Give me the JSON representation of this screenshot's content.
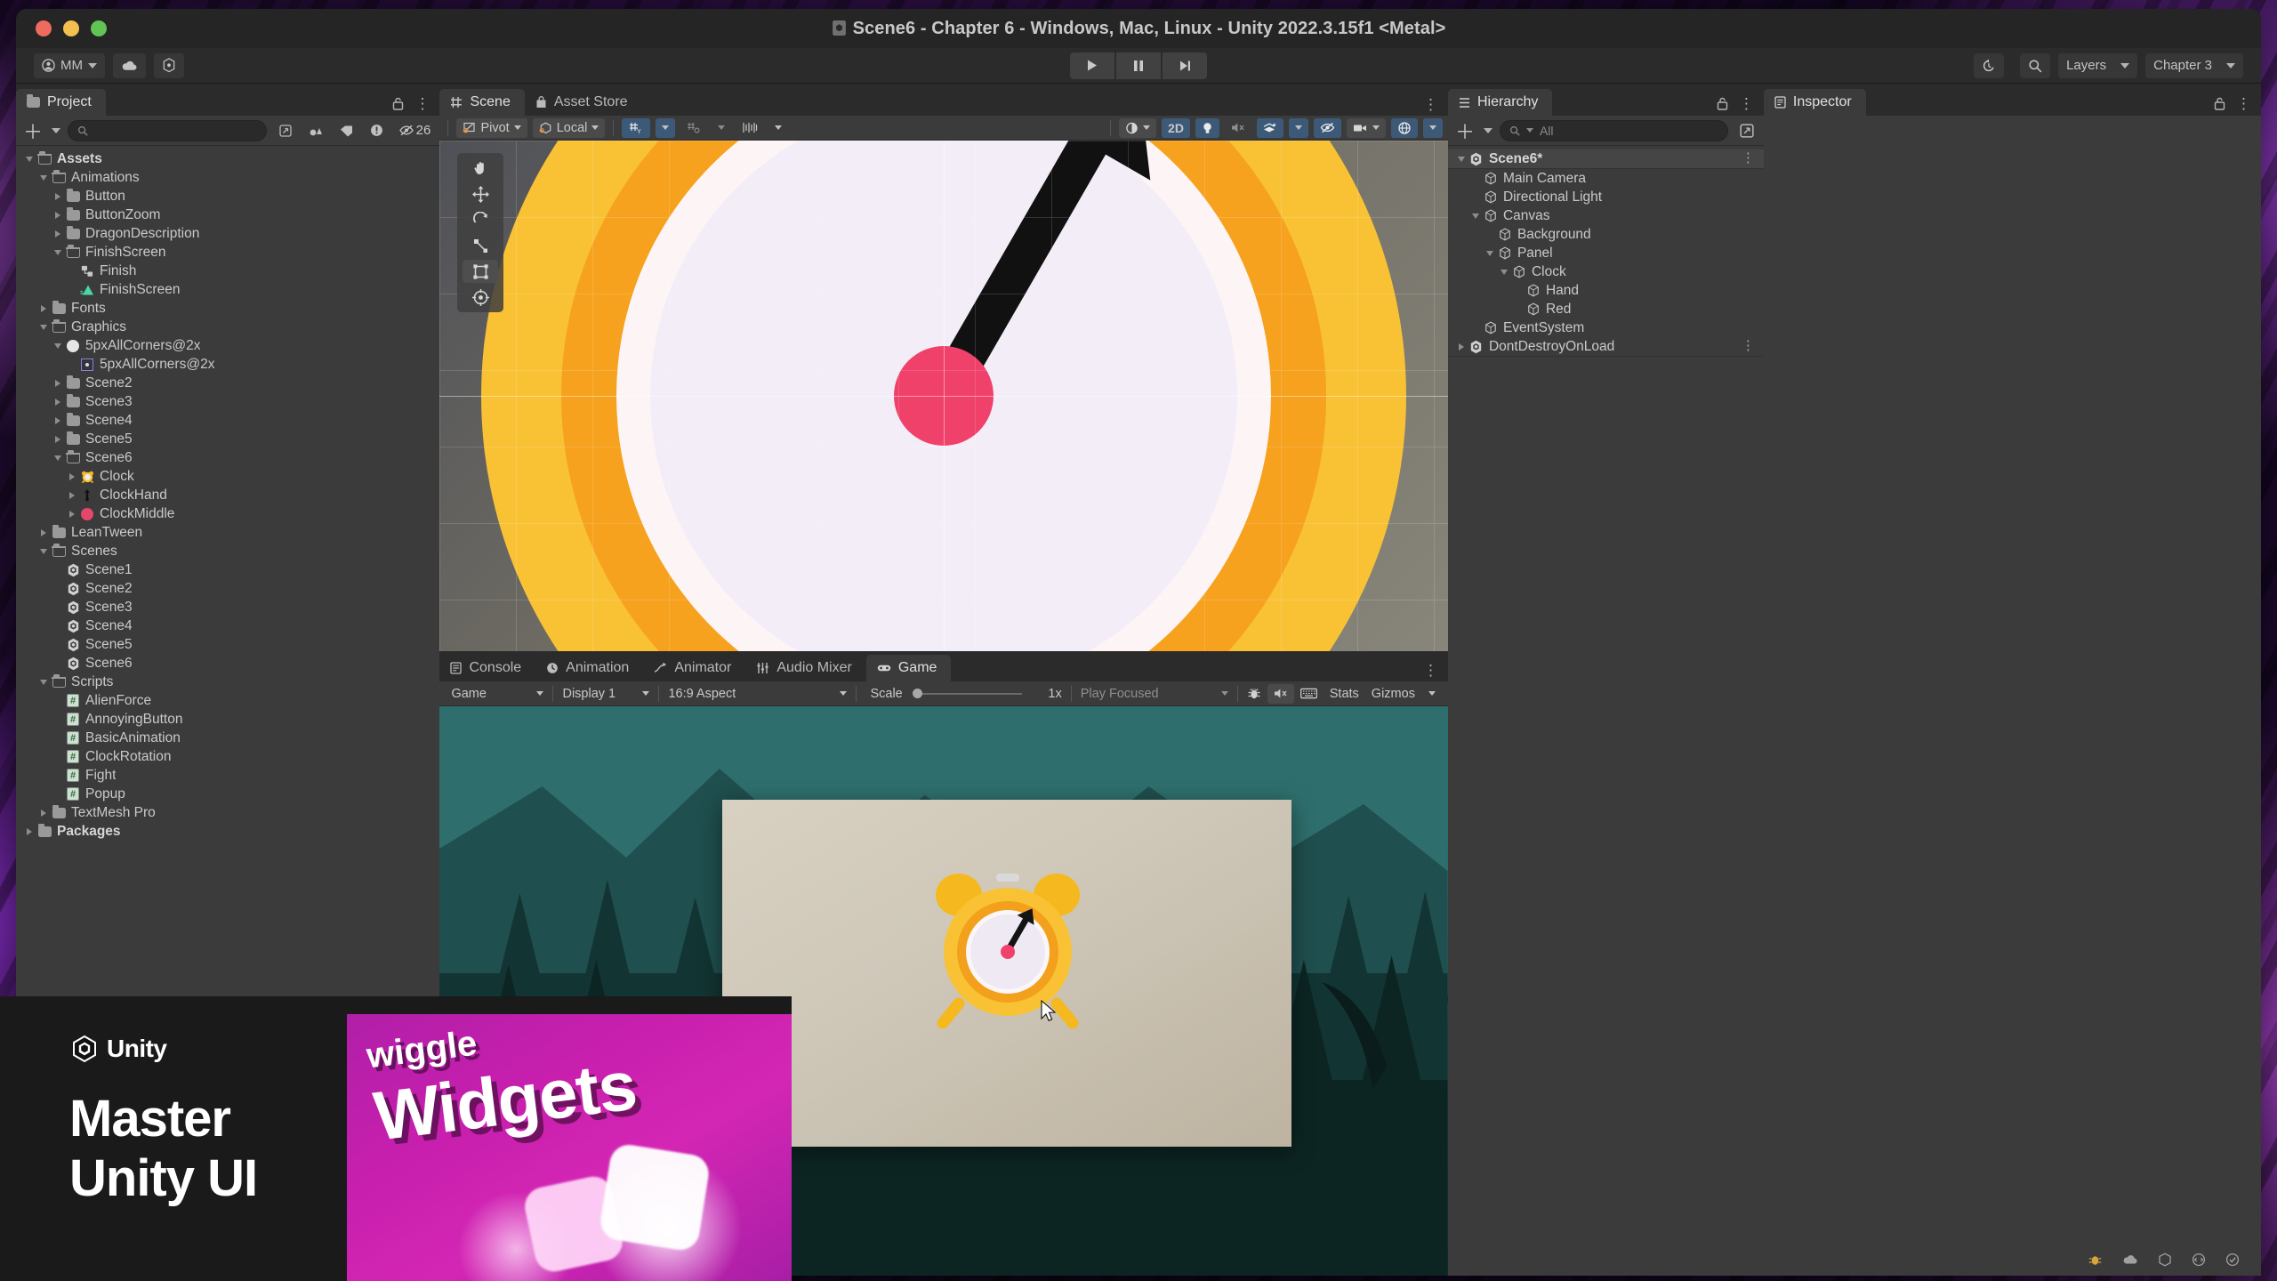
{
  "window": {
    "title": "Scene6 - Chapter 6 - Windows, Mac, Linux - Unity 2022.3.15f1 <Metal>",
    "title_icon": "unity-scene-icon"
  },
  "toolbar": {
    "account_label": "MM",
    "account_icon": "person-icon",
    "cloud_icon": "cloud-icon",
    "services_icon": "unity-services-icon",
    "play_icon": "play-icon",
    "pause_icon": "pause-icon",
    "step_icon": "step-icon",
    "history_icon": "undo-history-icon",
    "search_icon": "search-icon",
    "layers_label": "Layers",
    "layout_label": "Chapter 3"
  },
  "project": {
    "tab_label": "Project",
    "tab_icon": "folder-icon",
    "lock_icon": "lock-icon",
    "menu_icon": "kebab-menu-icon",
    "add_label": "+",
    "search_placeholder": "",
    "search_icon": "search-icon",
    "filter_icons": [
      "object-filter-icon",
      "label-filter-icon",
      "warning-filter-icon",
      "hidden-filter-icon"
    ],
    "hidden_count": "26",
    "tree": [
      {
        "label": "Assets",
        "depth": 0,
        "icon": "folder-open-icon",
        "expanded": true,
        "bold": true
      },
      {
        "label": "Animations",
        "depth": 1,
        "icon": "folder-open-icon",
        "expanded": true
      },
      {
        "label": "Button",
        "depth": 2,
        "icon": "folder-icon",
        "expanded": false
      },
      {
        "label": "ButtonZoom",
        "depth": 2,
        "icon": "folder-icon",
        "expanded": false
      },
      {
        "label": "DragonDescription",
        "depth": 2,
        "icon": "folder-icon",
        "expanded": false
      },
      {
        "label": "FinishScreen",
        "depth": 2,
        "icon": "folder-open-icon",
        "expanded": true
      },
      {
        "label": "Finish",
        "depth": 3,
        "icon": "animator-controller-icon"
      },
      {
        "label": "FinishScreen",
        "depth": 3,
        "icon": "animation-clip-icon"
      },
      {
        "label": "Fonts",
        "depth": 1,
        "icon": "folder-icon",
        "expanded": false
      },
      {
        "label": "Graphics",
        "depth": 1,
        "icon": "folder-open-icon",
        "expanded": true
      },
      {
        "label": "5pxAllCorners@2x",
        "depth": 2,
        "icon": "texture-circle-icon",
        "expanded": true
      },
      {
        "label": "5pxAllCorners@2x",
        "depth": 3,
        "icon": "sprite-icon"
      },
      {
        "label": "Scene2",
        "depth": 2,
        "icon": "folder-icon",
        "expanded": false
      },
      {
        "label": "Scene3",
        "depth": 2,
        "icon": "folder-icon",
        "expanded": false
      },
      {
        "label": "Scene4",
        "depth": 2,
        "icon": "folder-icon",
        "expanded": false
      },
      {
        "label": "Scene5",
        "depth": 2,
        "icon": "folder-icon",
        "expanded": false
      },
      {
        "label": "Scene6",
        "depth": 2,
        "icon": "folder-open-icon",
        "expanded": true
      },
      {
        "label": "Clock",
        "depth": 3,
        "icon": "alarm-clock-texture-icon",
        "expanded": false
      },
      {
        "label": "ClockHand",
        "depth": 3,
        "icon": "clock-hand-texture-icon",
        "expanded": false
      },
      {
        "label": "ClockMiddle",
        "depth": 3,
        "icon": "pink-circle-texture-icon",
        "expanded": false
      },
      {
        "label": "LeanTween",
        "depth": 1,
        "icon": "folder-icon",
        "expanded": false
      },
      {
        "label": "Scenes",
        "depth": 1,
        "icon": "folder-open-icon",
        "expanded": true
      },
      {
        "label": "Scene1",
        "depth": 2,
        "icon": "unity-scene-icon"
      },
      {
        "label": "Scene2",
        "depth": 2,
        "icon": "unity-scene-icon"
      },
      {
        "label": "Scene3",
        "depth": 2,
        "icon": "unity-scene-icon"
      },
      {
        "label": "Scene4",
        "depth": 2,
        "icon": "unity-scene-icon"
      },
      {
        "label": "Scene5",
        "depth": 2,
        "icon": "unity-scene-icon"
      },
      {
        "label": "Scene6",
        "depth": 2,
        "icon": "unity-scene-icon"
      },
      {
        "label": "Scripts",
        "depth": 1,
        "icon": "folder-open-icon",
        "expanded": true
      },
      {
        "label": "AlienForce",
        "depth": 2,
        "icon": "csharp-script-icon"
      },
      {
        "label": "AnnoyingButton",
        "depth": 2,
        "icon": "csharp-script-icon"
      },
      {
        "label": "BasicAnimation",
        "depth": 2,
        "icon": "csharp-script-icon"
      },
      {
        "label": "ClockRotation",
        "depth": 2,
        "icon": "csharp-script-icon"
      },
      {
        "label": "Fight",
        "depth": 2,
        "icon": "csharp-script-icon"
      },
      {
        "label": "Popup",
        "depth": 2,
        "icon": "csharp-script-icon"
      },
      {
        "label": "TextMesh Pro",
        "depth": 1,
        "icon": "folder-icon",
        "expanded": false
      },
      {
        "label": "Packages",
        "depth": 0,
        "icon": "folder-icon",
        "expanded": false,
        "bold": true
      }
    ]
  },
  "scene_panel": {
    "tabs": [
      {
        "label": "Scene",
        "icon": "scene-grid-icon",
        "active": true
      },
      {
        "label": "Asset Store",
        "icon": "asset-store-bag-icon",
        "active": false
      }
    ],
    "menu_icon": "kebab-menu-icon",
    "toolbar": {
      "pivot_label": "Pivot",
      "pivot_icon": "pivot-icon",
      "local_label": "Local",
      "local_icon": "local-space-icon",
      "grid_icon": "grid-axis-y-icon",
      "snap_icon": "snap-increment-icon",
      "ruler_icon": "grid-size-icon",
      "shading_icon": "shading-mode-icon",
      "mode_2d_label": "2D",
      "light_icon": "lighting-icon",
      "audio_icon": "audio-mute-icon",
      "fx_icon": "effects-icon",
      "visibility_icon": "scene-visibility-icon",
      "camera_icon": "scene-camera-icon",
      "gizmos_icon": "gizmos-globe-icon"
    },
    "tools": [
      "hand-tool-icon",
      "move-tool-icon",
      "rotate-tool-icon",
      "scale-tool-icon",
      "rect-tool-icon",
      "transform-tool-icon"
    ],
    "active_tool": "rect-tool-icon"
  },
  "bottom_panel": {
    "tabs": [
      {
        "label": "Console",
        "icon": "console-icon",
        "active": false
      },
      {
        "label": "Animation",
        "icon": "animation-clock-icon",
        "active": false
      },
      {
        "label": "Animator",
        "icon": "animator-arrow-icon",
        "active": false
      },
      {
        "label": "Audio Mixer",
        "icon": "audio-mixer-icon",
        "active": false
      },
      {
        "label": "Game",
        "icon": "gamepad-icon",
        "active": true
      }
    ],
    "menu_icon": "kebab-menu-icon",
    "game_toolbar": {
      "target_label": "Game",
      "display_label": "Display 1",
      "aspect_label": "16:9 Aspect",
      "scale_label": "Scale",
      "scale_value": "1x",
      "play_mode_label": "Play Focused",
      "mute_icon": "audio-mute-icon",
      "debug_icon": "debug-bug-icon",
      "shortcuts_icon": "keyboard-shortcuts-icon",
      "stats_label": "Stats",
      "gizmos_label": "Gizmos"
    }
  },
  "hierarchy": {
    "tab_label": "Hierarchy",
    "tab_icon": "hierarchy-list-icon",
    "lock_icon": "lock-icon",
    "menu_icon": "kebab-menu-icon",
    "add_label": "+",
    "search_placeholder": "All",
    "search_icon": "search-icon",
    "expand_icon": "expand-window-icon",
    "items": [
      {
        "label": "Scene6*",
        "depth": 0,
        "icon": "unity-scene-icon",
        "expanded": true,
        "bold": true,
        "menu": true
      },
      {
        "label": "Main Camera",
        "depth": 1,
        "icon": "gameobject-cube-icon"
      },
      {
        "label": "Directional Light",
        "depth": 1,
        "icon": "gameobject-cube-icon"
      },
      {
        "label": "Canvas",
        "depth": 1,
        "icon": "gameobject-cube-icon",
        "expanded": true
      },
      {
        "label": "Background",
        "depth": 2,
        "icon": "gameobject-cube-icon"
      },
      {
        "label": "Panel",
        "depth": 2,
        "icon": "gameobject-cube-icon",
        "expanded": true
      },
      {
        "label": "Clock",
        "depth": 3,
        "icon": "gameobject-cube-icon",
        "expanded": true
      },
      {
        "label": "Hand",
        "depth": 4,
        "icon": "gameobject-cube-icon"
      },
      {
        "label": "Red",
        "depth": 4,
        "icon": "gameobject-cube-icon"
      },
      {
        "label": "EventSystem",
        "depth": 1,
        "icon": "gameobject-cube-icon"
      },
      {
        "label": "DontDestroyOnLoad",
        "depth": 0,
        "icon": "unity-scene-icon",
        "expanded": false,
        "menu": true
      }
    ]
  },
  "inspector": {
    "tab_label": "Inspector",
    "tab_icon": "inspector-icon",
    "lock_icon": "lock-icon",
    "menu_icon": "kebab-menu-icon"
  },
  "status_bar": {
    "icons": [
      "bug-report-icon",
      "cloud-status-icon",
      "package-status-icon",
      "code-optimization-icon",
      "check-status-icon"
    ]
  },
  "promo": {
    "brand_label": "Unity",
    "brand_icon": "unity-logo-icon",
    "heading_line1": "Master",
    "heading_line2": "Unity UI",
    "card_small_label": "wiggle",
    "card_big_label": "Widgets"
  },
  "colors": {
    "accent_blue": "#3c5a78",
    "panel_bg": "#3b3b3b",
    "toolbar_bg": "#2b2b2b",
    "clock_yellow": "#f7b82c",
    "clock_orange": "#f18b1f",
    "clock_pink": "#ef4a68",
    "promo_magenta": "#c81fae"
  }
}
